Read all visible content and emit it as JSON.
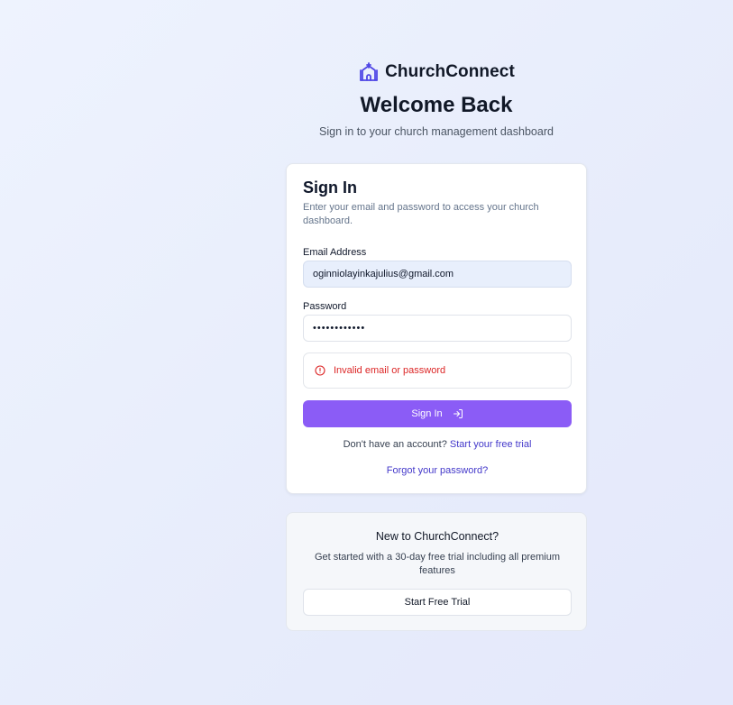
{
  "brand": {
    "name": "ChurchConnect",
    "icon": "church-icon",
    "accent_color": "#4f46e5"
  },
  "header": {
    "title": "Welcome Back",
    "subtitle": "Sign in to your church management dashboard"
  },
  "signin_card": {
    "title": "Sign In",
    "description": "Enter your email and password to access your church dashboard.",
    "email_label": "Email Address",
    "email_value": "oginniolayinkajulius@gmail.com",
    "password_label": "Password",
    "password_value": "••••••••••••",
    "error_icon": "alert-circle-icon",
    "error_message": "Invalid email or password",
    "submit_label": "Sign In",
    "submit_icon": "login-arrow-icon",
    "no_account_text": "Don't have an account?",
    "trial_link": "Start your free trial",
    "forgot_link": "Forgot your password?"
  },
  "promo_card": {
    "title": "New to ChurchConnect?",
    "description": "Get started with a 30-day free trial including all premium features",
    "button_label": "Start Free Trial"
  },
  "colors": {
    "primary_button": "#8b5cf6",
    "link": "#4338ca",
    "error": "#dc2626"
  }
}
